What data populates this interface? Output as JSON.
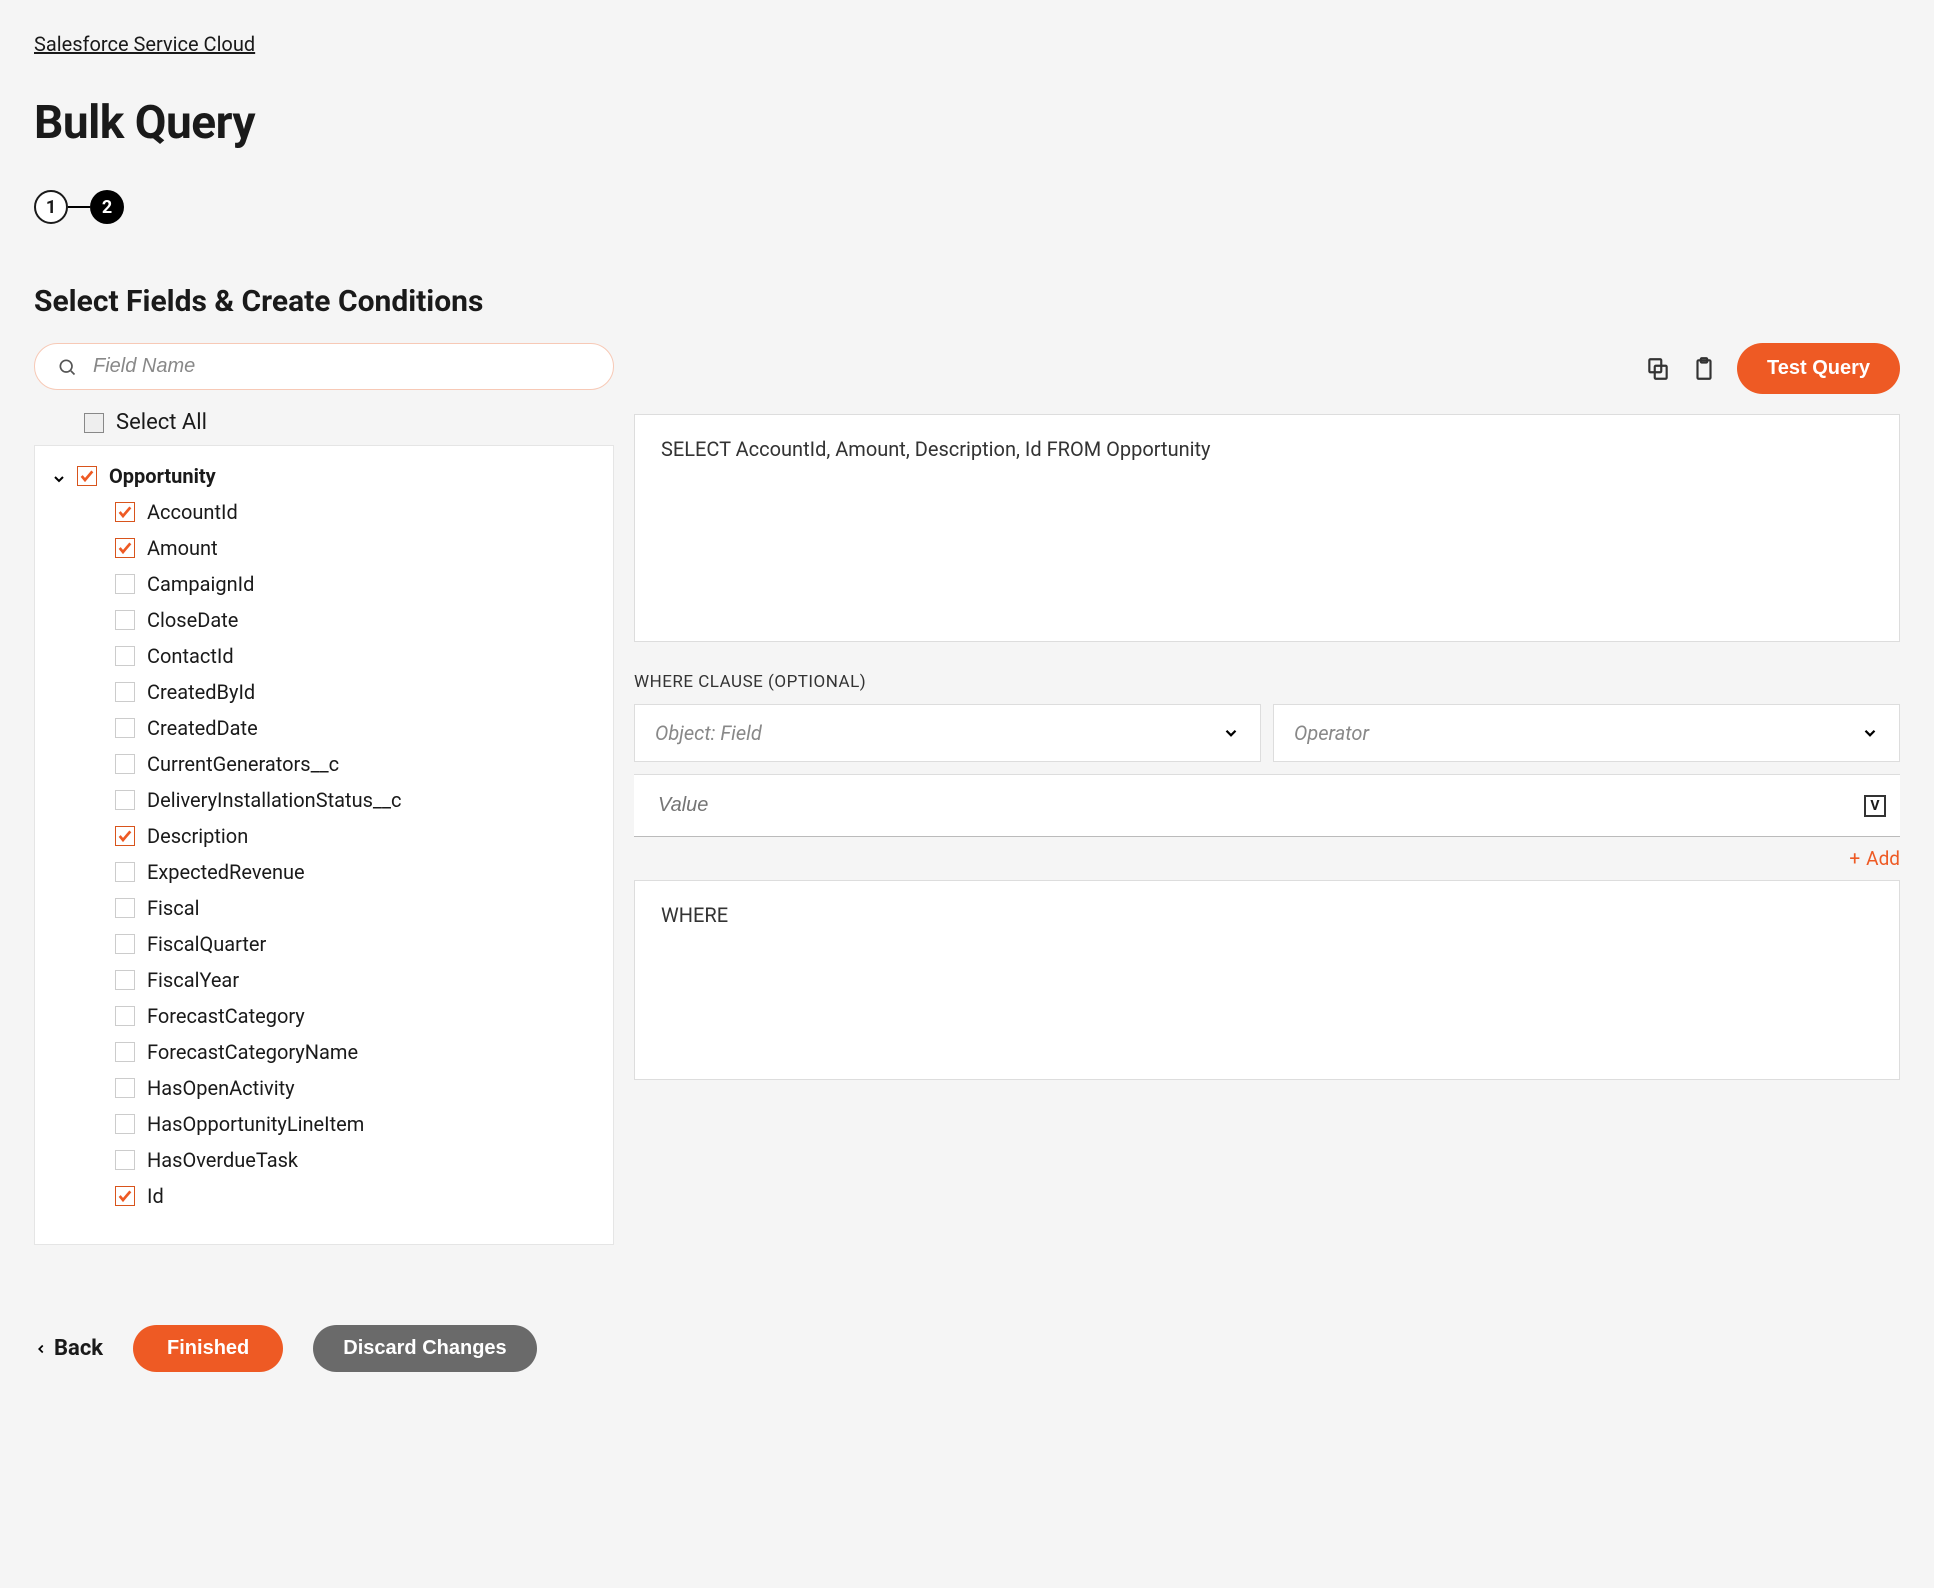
{
  "breadcrumb": "Salesforce Service Cloud",
  "page_title": "Bulk Query",
  "stepper": {
    "step1": "1",
    "step2": "2"
  },
  "section_title": "Select Fields & Create Conditions",
  "search": {
    "placeholder": "Field Name"
  },
  "select_all_label": "Select All",
  "tree": {
    "root_label": "Opportunity",
    "root_checked": true,
    "fields": [
      {
        "label": "AccountId",
        "checked": true
      },
      {
        "label": "Amount",
        "checked": true
      },
      {
        "label": "CampaignId",
        "checked": false
      },
      {
        "label": "CloseDate",
        "checked": false
      },
      {
        "label": "ContactId",
        "checked": false
      },
      {
        "label": "CreatedById",
        "checked": false
      },
      {
        "label": "CreatedDate",
        "checked": false
      },
      {
        "label": "CurrentGenerators__c",
        "checked": false
      },
      {
        "label": "DeliveryInstallationStatus__c",
        "checked": false
      },
      {
        "label": "Description",
        "checked": true
      },
      {
        "label": "ExpectedRevenue",
        "checked": false
      },
      {
        "label": "Fiscal",
        "checked": false
      },
      {
        "label": "FiscalQuarter",
        "checked": false
      },
      {
        "label": "FiscalYear",
        "checked": false
      },
      {
        "label": "ForecastCategory",
        "checked": false
      },
      {
        "label": "ForecastCategoryName",
        "checked": false
      },
      {
        "label": "HasOpenActivity",
        "checked": false
      },
      {
        "label": "HasOpportunityLineItem",
        "checked": false
      },
      {
        "label": "HasOverdueTask",
        "checked": false
      },
      {
        "label": "Id",
        "checked": true
      }
    ]
  },
  "right": {
    "test_query_label": "Test Query",
    "query_text": "SELECT AccountId, Amount, Description, Id FROM Opportunity",
    "where_label": "WHERE CLAUSE (OPTIONAL)",
    "object_field_placeholder": "Object: Field",
    "operator_placeholder": "Operator",
    "value_placeholder": "Value",
    "v_label": "V",
    "add_label": "Add",
    "where_output": "WHERE"
  },
  "footer": {
    "back_label": "Back",
    "finished_label": "Finished",
    "discard_label": "Discard Changes"
  }
}
